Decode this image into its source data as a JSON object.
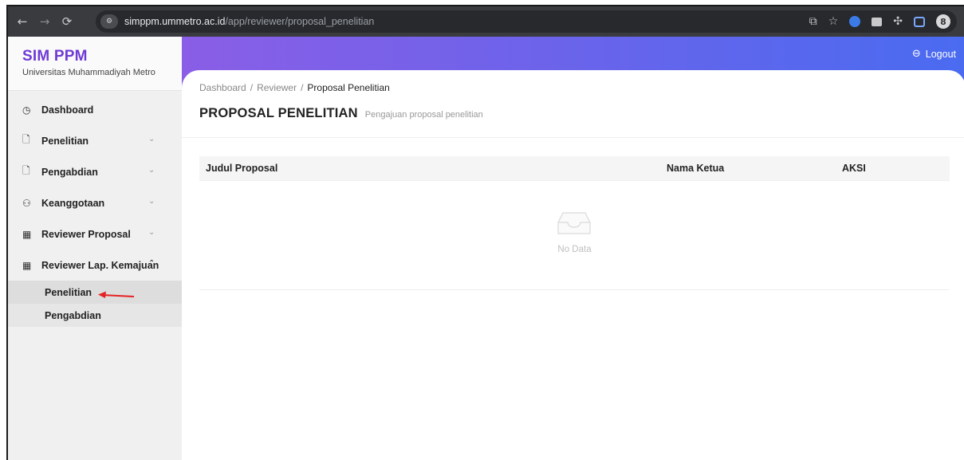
{
  "browser": {
    "url_host": "simppm.ummetro.ac.id",
    "url_path": "/app/reviewer/proposal_penelitian",
    "profile_initial": "8",
    "icons": [
      "back-arrow-icon",
      "forward-arrow-icon",
      "reload-icon",
      "site-info-icon",
      "share-icon",
      "star-icon",
      "extension-icon",
      "sidebar-icon",
      "profile-icon"
    ]
  },
  "brand": {
    "title": "SIM PPM",
    "subtitle": "Universitas Muhammadiyah Metro",
    "color": "#6f3ad6"
  },
  "sidebar": {
    "items": [
      {
        "label": "Dashboard",
        "icon": "dashboard-icon"
      },
      {
        "label": "Penelitian",
        "icon": "document-icon",
        "expandable": true
      },
      {
        "label": "Pengabdian",
        "icon": "document-icon",
        "expandable": true
      },
      {
        "label": "Keanggotaan",
        "icon": "users-icon",
        "expandable": true
      },
      {
        "label": "Reviewer Proposal",
        "icon": "form-icon",
        "expandable": true
      },
      {
        "label": "Reviewer Lap. Kemajuan",
        "icon": "form-icon",
        "expandable": true,
        "expanded": true
      }
    ],
    "submenu": [
      {
        "label": "Penelitian",
        "active": true
      },
      {
        "label": "Pengabdian",
        "active": false
      }
    ]
  },
  "header": {
    "logout_label": "Logout",
    "gradient": [
      "#8a5ee6",
      "#4a6bf0"
    ]
  },
  "breadcrumb": {
    "items": [
      "Dashboard",
      "Reviewer"
    ],
    "separator": "/",
    "current": "Proposal Penelitian"
  },
  "page": {
    "title": "PROPOSAL PENELITIAN",
    "subtitle": "Pengajuan proposal penelitian"
  },
  "table": {
    "columns": [
      "Judul Proposal",
      "Nama Ketua",
      "AKSI"
    ],
    "rows": [],
    "empty_text": "No Data"
  },
  "annotation": {
    "arrow_color": "#e52222"
  }
}
